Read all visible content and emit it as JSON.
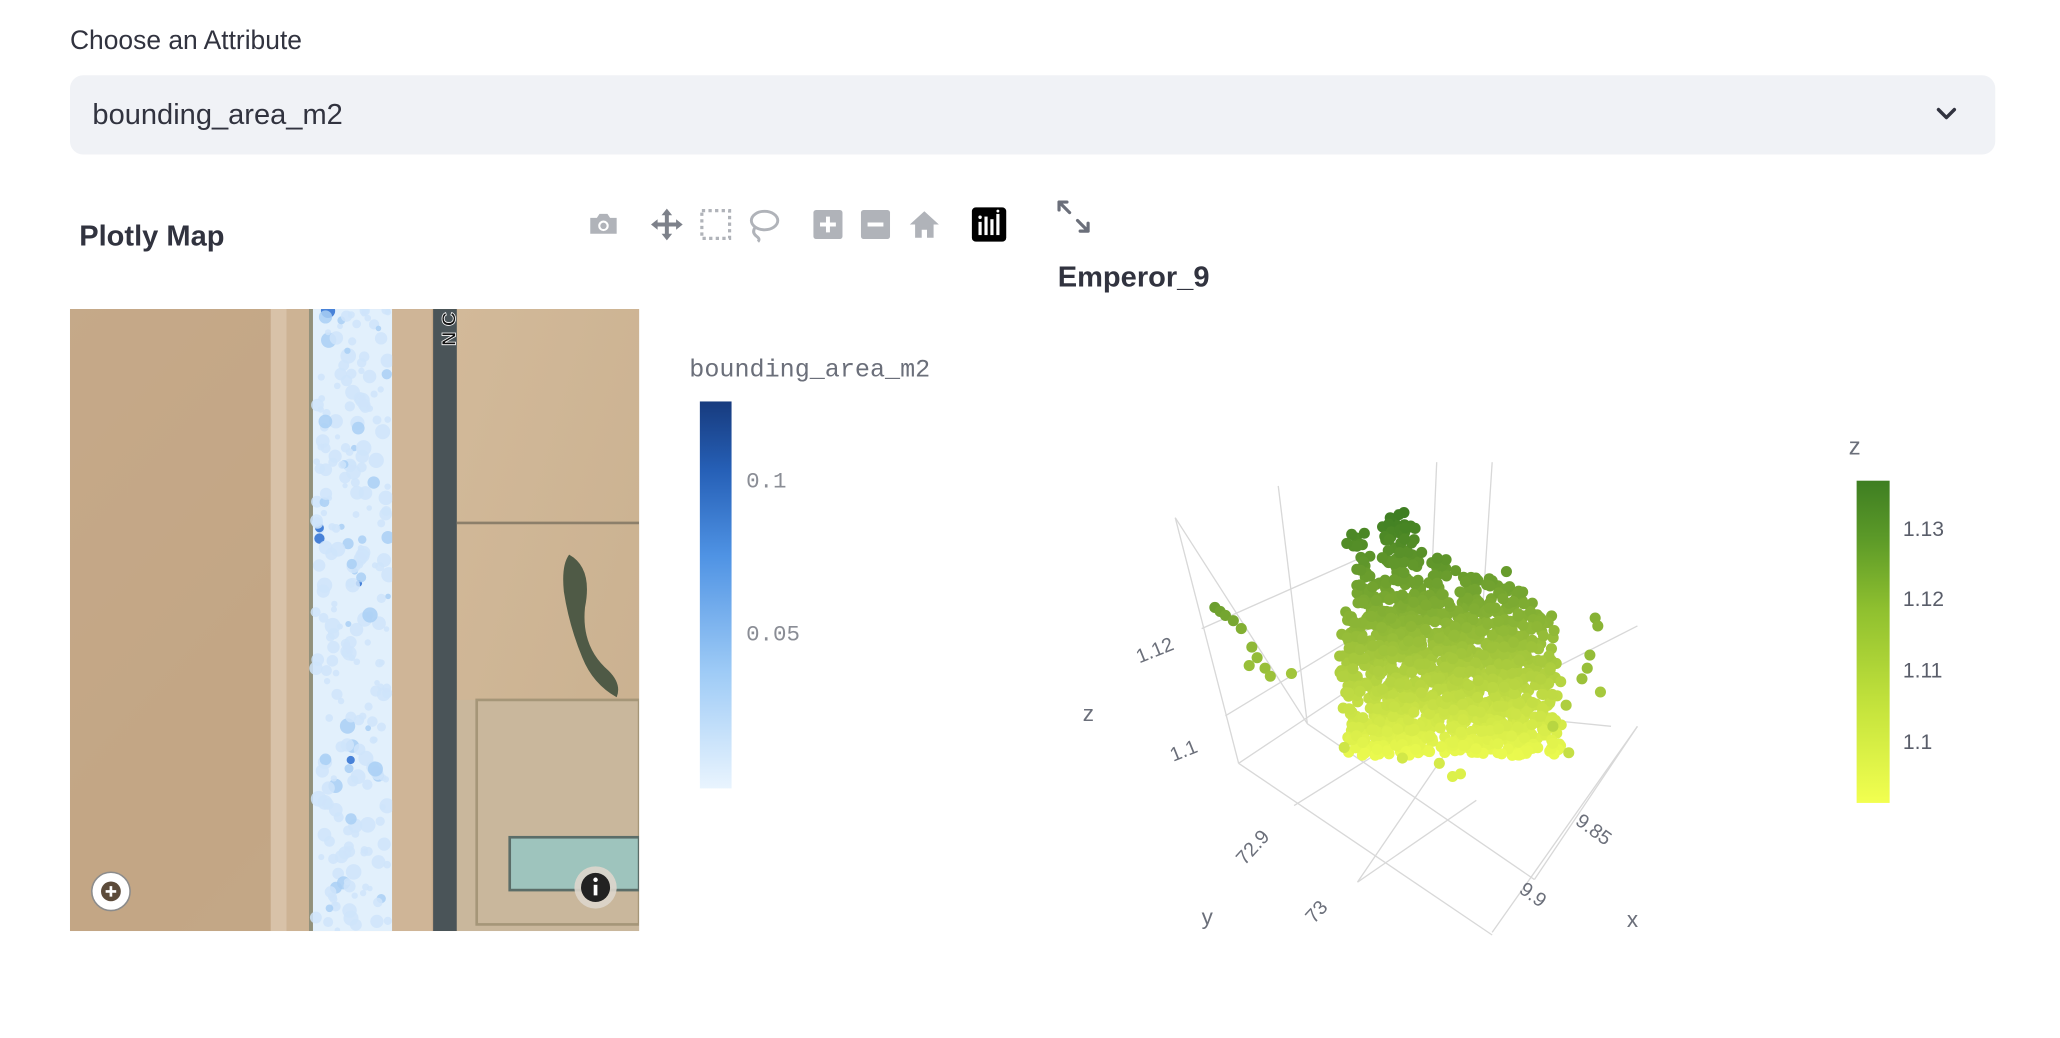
{
  "attribute": {
    "label": "Choose an Attribute",
    "selected": "bounding_area_m2"
  },
  "map_panel": {
    "title": "Plotly Map",
    "road_label": "N C",
    "colorbar": {
      "title": "bounding_area_m2",
      "ticks": [
        "0.1",
        "0.05"
      ]
    }
  },
  "modebar": [
    "camera-icon",
    "pan-icon",
    "box-select-icon",
    "lasso-select-icon",
    "zoom-in-icon",
    "zoom-out-icon",
    "reset-home-icon",
    "plotly-logo-icon"
  ],
  "scatter3d": {
    "title": "Emperor_9",
    "axes": {
      "x": {
        "label": "x",
        "ticks": [
          "9.85",
          "9.9"
        ]
      },
      "y": {
        "label": "y",
        "ticks": [
          "72.9",
          "73"
        ]
      },
      "z": {
        "label": "z",
        "ticks": [
          "1.12",
          "1.1"
        ]
      }
    },
    "colorbar": {
      "title": "z",
      "ticks": [
        "1.13",
        "1.12",
        "1.11",
        "1.1"
      ]
    }
  },
  "colors": {
    "map_scale_low": "#e9f4fe",
    "map_scale_high": "#173b7e",
    "z_scale_low": "#f2ff50",
    "z_scale_high": "#3e7e22"
  }
}
